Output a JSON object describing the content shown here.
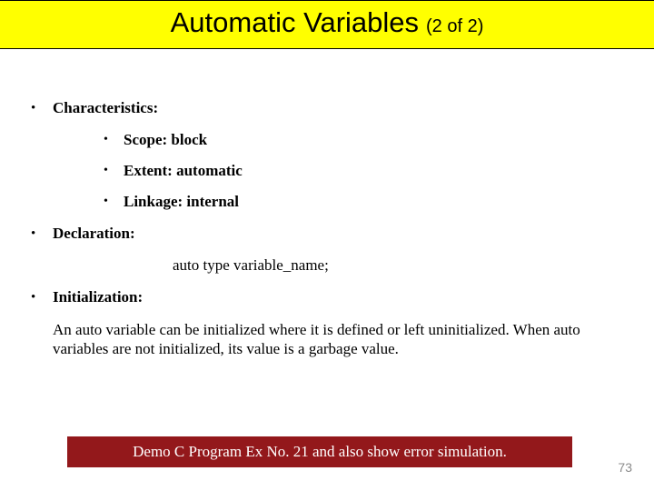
{
  "title": {
    "main": "Automatic Variables",
    "sub": "(2 of 2)"
  },
  "items": {
    "characteristics": {
      "label": "Characteristics:",
      "sub": {
        "scope": "Scope: block",
        "extent": "Extent: automatic",
        "linkage": "Linkage: internal"
      }
    },
    "declaration": {
      "label": "Declaration:",
      "code": "auto type variable_name;"
    },
    "initialization": {
      "label": "Initialization:",
      "body": "An auto variable can be initialized where it is defined or left uninitialized. When auto variables are not initialized, its value is a garbage value."
    }
  },
  "demo": "Demo C Program Ex No. 21 and also show error simulation.",
  "page": "73"
}
